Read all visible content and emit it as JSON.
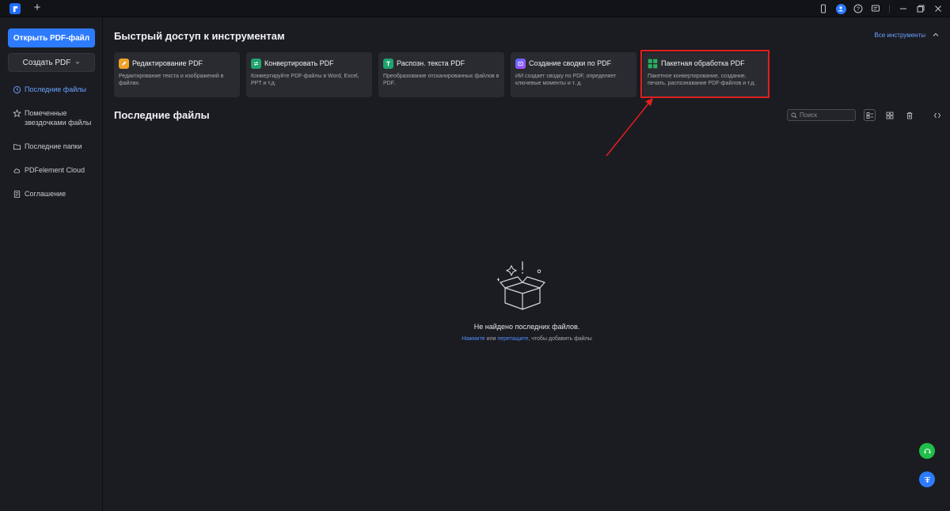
{
  "titlebar": {
    "new_tab": "+",
    "icons": [
      "phone-icon",
      "avatar-icon",
      "help-icon",
      "chat-icon",
      "minimize-icon",
      "restore-icon",
      "close-icon"
    ]
  },
  "sidebar": {
    "open_button": "Открыть PDF-файл",
    "create_button": "Создать PDF",
    "items": [
      {
        "label": "Последние файлы",
        "icon": "clock-icon",
        "active": true
      },
      {
        "label": "Помеченные звездочками файлы",
        "icon": "star-icon",
        "active": false
      },
      {
        "label": "Последние папки",
        "icon": "folder-icon",
        "active": false
      },
      {
        "label": "PDFelement Cloud",
        "icon": "cloud-icon",
        "active": false
      },
      {
        "label": "Соглашение",
        "icon": "document-icon",
        "active": false
      }
    ]
  },
  "quick_access": {
    "title": "Быстрый доступ к инструментам",
    "all_tools": "Все инструменты",
    "cards": [
      {
        "title": "Редактирование PDF",
        "desc": "Редактирование текста и изображений в файлах.",
        "color": "#f0a12a",
        "icon": "edit-pdf-icon"
      },
      {
        "title": "Конвертировать PDF",
        "desc": "Конвертируйте PDF-файлы в Word, Excel, PPT и т.д.",
        "color": "#1fa36f",
        "icon": "convert-icon"
      },
      {
        "title": "Распозн. текста PDF",
        "desc": "Преобразование отсканированных файлов в PDF.",
        "color": "#1fa36f",
        "icon": "ocr-icon"
      },
      {
        "title": "Создание сводки по PDF",
        "desc": "ИИ создает сводку по PDF, определяет ключевые моменты и т. д.",
        "color": "#7b5cff",
        "icon": "ai-summary-icon"
      },
      {
        "title": "Пакетная обработка PDF",
        "desc": "Пакетное конвертирование, создание, печать, распознавание PDF-файлов и т.д.",
        "color": "#27b05f",
        "icon": "batch-icon"
      }
    ]
  },
  "recent": {
    "title": "Последние файлы",
    "search_placeholder": "Поиск",
    "empty_title": "Не найдено последних файлов.",
    "empty_click": "Нажмите",
    "empty_or": "или",
    "empty_drag": "перетащите",
    "empty_suffix": ", чтобы добавить файлы"
  },
  "colors": {
    "accent": "#2d7bff",
    "highlight": "#e02020",
    "support_green": "#1fbf4a"
  }
}
